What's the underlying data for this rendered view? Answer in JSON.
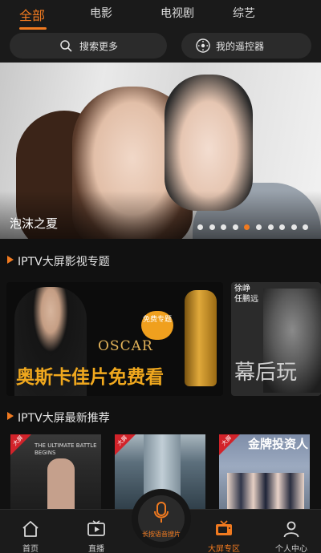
{
  "header": {
    "tabs": [
      {
        "label": "全部",
        "active": true
      },
      {
        "label": "电影",
        "active": false
      },
      {
        "label": "电视剧",
        "active": false
      },
      {
        "label": "综艺",
        "active": false
      }
    ],
    "search_label": "搜索更多",
    "remote_label": "我的遥控器"
  },
  "banner": {
    "title": "泡沫之夏",
    "dot_count": 10,
    "active_dot": 4
  },
  "topics": {
    "section_title": "IPTV大屏影视专题",
    "cards": [
      {
        "badge": "免费专题",
        "logo": "OSCAR",
        "headline": "奥斯卡佳片免费看"
      },
      {
        "names": [
          "徐峥",
          "任鹏远"
        ],
        "headline": "幕后玩"
      }
    ]
  },
  "latest": {
    "section_title": "IPTV大屏最新推荐",
    "posters": [
      {
        "corner": "大屏",
        "text": "THE ULTIMATE BATTLE BEGINS"
      },
      {
        "corner": "大屏"
      },
      {
        "corner": "大屏",
        "title": "金牌投资人"
      }
    ]
  },
  "bottom_nav": {
    "items": [
      {
        "label": "首页",
        "icon": "home-icon"
      },
      {
        "label": "直播",
        "icon": "tv-play-icon"
      },
      {
        "label": "大屏专区",
        "icon": "retro-tv-icon",
        "active": true
      },
      {
        "label": "个人中心",
        "icon": "person-icon"
      }
    ],
    "voice_label": "长按语音搜片",
    "voice_icon": "microphone-icon"
  },
  "colors": {
    "accent": "#f07a20",
    "background": "#111111",
    "pill": "#2b2b2b"
  }
}
